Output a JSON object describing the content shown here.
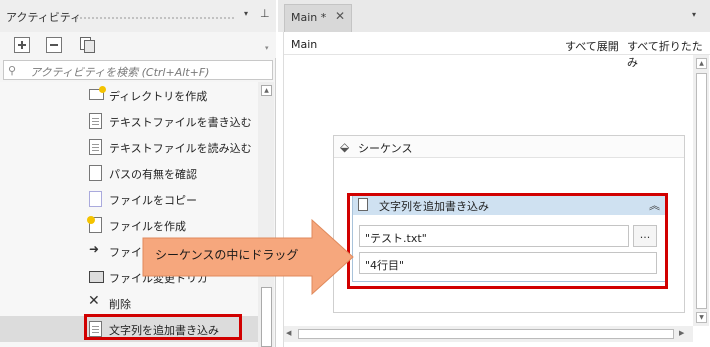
{
  "activities_panel": {
    "title": "アクティビティ",
    "menu_icon": "▾",
    "pin_icon": "ꟷ",
    "search_placeholder": "アクティビティを検索 (Ctrl+Alt+F)",
    "items": [
      {
        "label": "ディレクトリを作成",
        "icon": "folder-new-icon"
      },
      {
        "label": "テキストファイルを書き込む",
        "icon": "text-file-icon"
      },
      {
        "label": "テキストファイルを読み込む",
        "icon": "text-file-icon"
      },
      {
        "label": "パスの有無を確認",
        "icon": "path-icon"
      },
      {
        "label": "ファイルをコピー",
        "icon": "file-copy-icon"
      },
      {
        "label": "ファイルを作成",
        "icon": "file-new-icon"
      },
      {
        "label": "ファイル",
        "icon": "file-move-icon"
      },
      {
        "label": "ファイル変更トリガ",
        "icon": "monitor-icon"
      },
      {
        "label": "削除",
        "icon": "delete-icon"
      },
      {
        "label": "文字列を追加書き込み",
        "icon": "document-icon"
      }
    ]
  },
  "designer": {
    "tab_label": "Main *",
    "tab_close": "✕",
    "breadcrumb": "Main",
    "expand_all": "すべて展開",
    "collapse_all": "すべて折りたたみ",
    "sequence": {
      "title": "シーケンス",
      "activity": {
        "title": "文字列を追加書き込み",
        "file_value": "\"テスト.txt\"",
        "browse_label": "...",
        "text_value": "\"4行目\""
      }
    }
  },
  "callout": {
    "text": "シーケンスの中にドラッグ",
    "color": "#f6a77d"
  },
  "highlight_color": "#d10000"
}
